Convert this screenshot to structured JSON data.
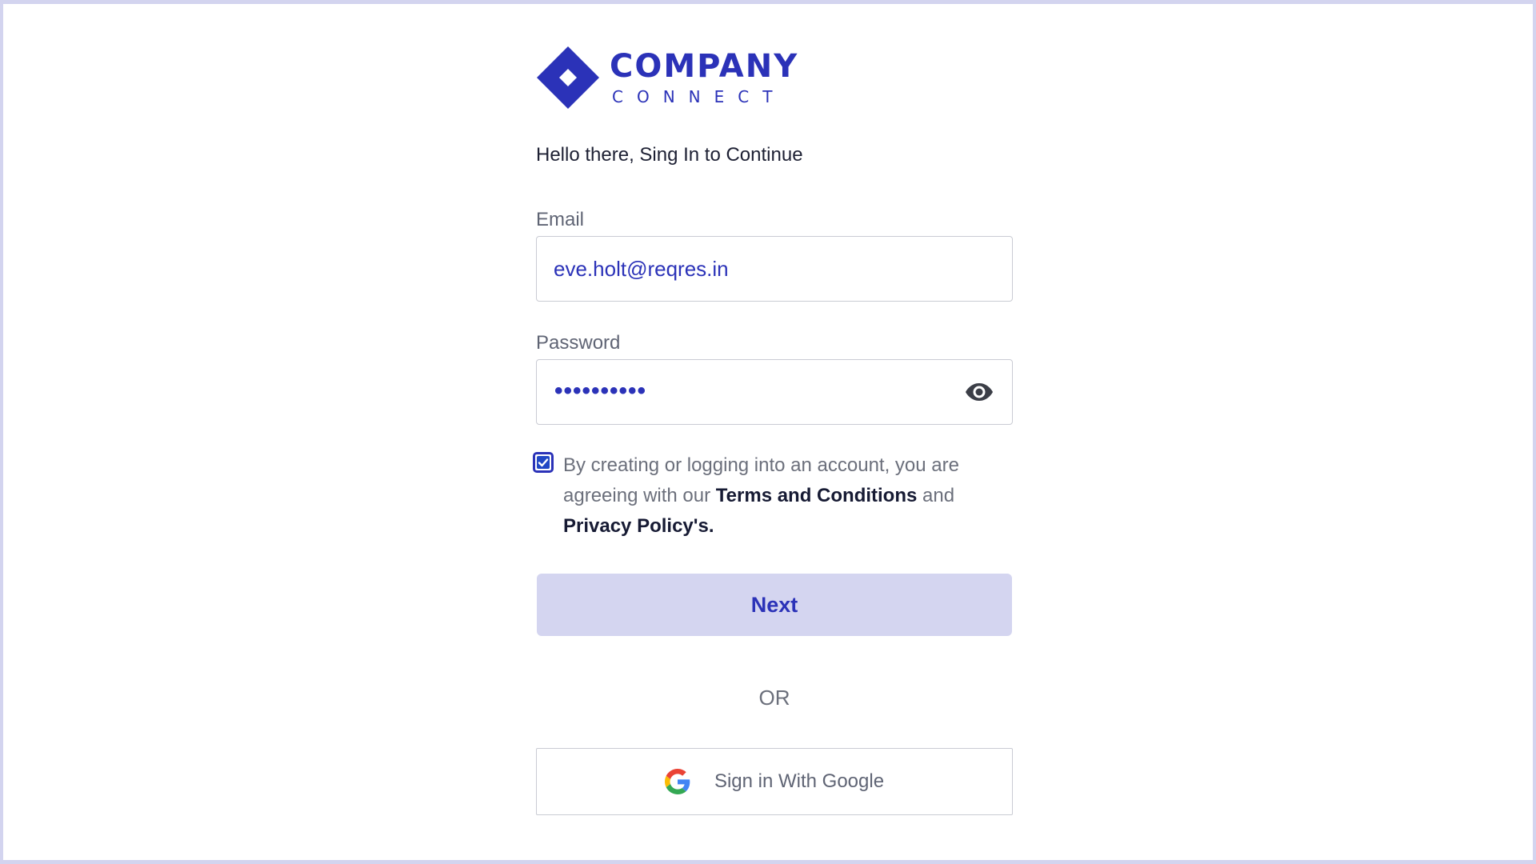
{
  "brand": {
    "name_top": "COMPANY",
    "name_bottom": "CONNECT",
    "color": "#2b32b8"
  },
  "greeting": "Hello there, Sing In to Continue",
  "form": {
    "email_label": "Email",
    "email_value": "eve.holt@reqres.in",
    "password_label": "Password",
    "password_value": "••••••••••",
    "show_password_icon": "eye-icon"
  },
  "terms": {
    "checked": true,
    "prefix": "By creating or logging into an account, you are agreeing with our ",
    "terms_link": "Terms and Conditions",
    "middle": " and ",
    "privacy_link": "Privacy Policy's."
  },
  "actions": {
    "next_label": "Next",
    "or_label": "OR",
    "google_label": "Sign in With Google",
    "google_icon": "google-icon"
  }
}
